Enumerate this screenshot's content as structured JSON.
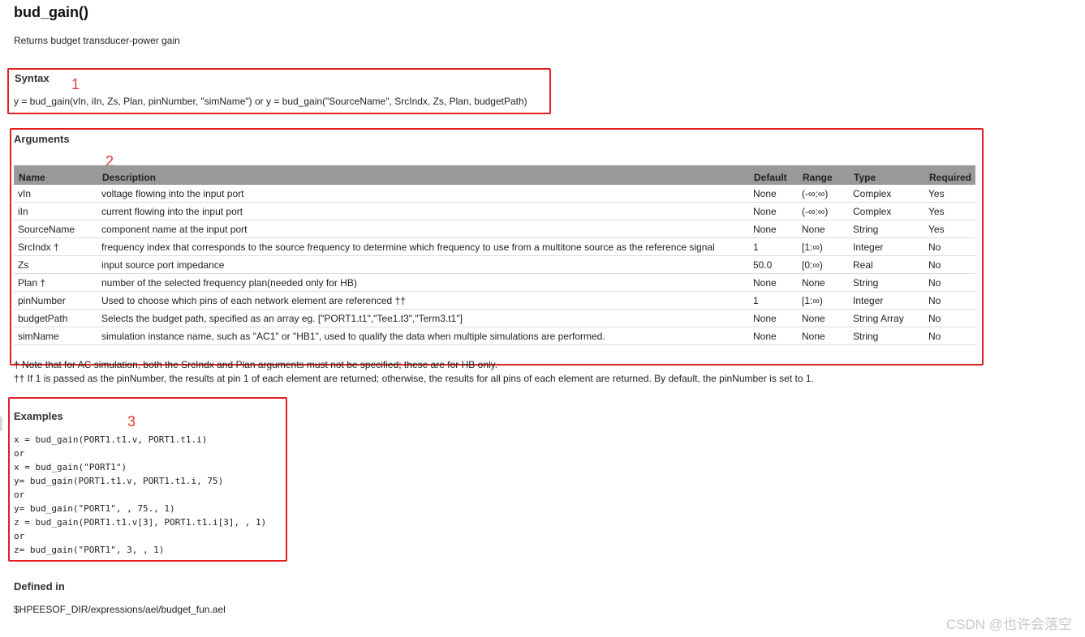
{
  "page": {
    "title": "bud_gain()",
    "description": "Returns budget transducer-power gain"
  },
  "syntax": {
    "heading": "Syntax",
    "text": "y = bud_gain(vIn, iIn, Zs, Plan, pinNumber, \"simName\") or y = bud_gain(\"SourceName\", SrcIndx, Zs, Plan, budgetPath)"
  },
  "arguments": {
    "heading": "Arguments",
    "columns": [
      "Name",
      "Description",
      "Default",
      "Range",
      "Type",
      "Required"
    ],
    "rows": [
      [
        "vIn",
        "voltage flowing into the input port",
        "None",
        "(-∞:∞)",
        "Complex",
        "Yes"
      ],
      [
        "iIn",
        "current flowing into the input port",
        "None",
        "(-∞:∞)",
        "Complex",
        "Yes"
      ],
      [
        "SourceName",
        "component name at the input port",
        "None",
        "None",
        "String",
        "Yes"
      ],
      [
        "SrcIndx †",
        "frequency index that corresponds to the source frequency to determine which frequency to use from a multitone source as the reference signal",
        "1",
        "[1:∞)",
        "Integer",
        "No"
      ],
      [
        "Zs",
        "input source port impedance",
        "50.0",
        "[0:∞)",
        "Real",
        "No"
      ],
      [
        "Plan †",
        "number of the selected frequency plan(needed only for HB)",
        "None",
        "None",
        "String",
        "No"
      ],
      [
        "pinNumber",
        "Used to choose which pins of each network element are referenced ††",
        "1",
        "[1:∞)",
        "Integer",
        "No"
      ],
      [
        "budgetPath",
        "Selects the budget path, specified as an array eg. [\"PORT1.t1\",\"Tee1.t3\",\"Term3.t1\"]",
        "None",
        "None",
        "String Array",
        "No"
      ],
      [
        "simName",
        "simulation instance name, such as \"AC1\" or \"HB1\", used to qualify the data when multiple simulations are performed.",
        "None",
        "None",
        "String",
        "No"
      ]
    ]
  },
  "notes": {
    "note1": "† Note that for AC simulation, both the SrcIndx and Plan arguments must not be specified; these are for HB only.",
    "note2": "†† If 1 is passed as the pinNumber, the results at pin 1 of each element are returned; otherwise, the results for all pins of each element are returned. By default, the pinNumber is set to 1."
  },
  "examples": {
    "heading": "Examples",
    "lines": [
      "x = bud_gain(PORT1.t1.v, PORT1.t1.i)",
      "or",
      "x = bud_gain(\"PORT1\")",
      "y= bud_gain(PORT1.t1.v, PORT1.t1.i, 75)",
      "or",
      "y= bud_gain(\"PORT1\", , 75., 1)",
      "z = bud_gain(PORT1.t1.v[3], PORT1.t1.i[3], , 1)",
      "or",
      "z= bud_gain(\"PORT1\", 3, , 1)"
    ]
  },
  "defined_in": {
    "heading": "Defined in",
    "path": "$HPEESOF_DIR/expressions/ael/budget_fun.ael"
  },
  "annotations": {
    "marker1": "1",
    "marker2": "2",
    "marker3": "3",
    "box_color": "#e02020"
  },
  "watermark": "CSDN @也许会落空"
}
